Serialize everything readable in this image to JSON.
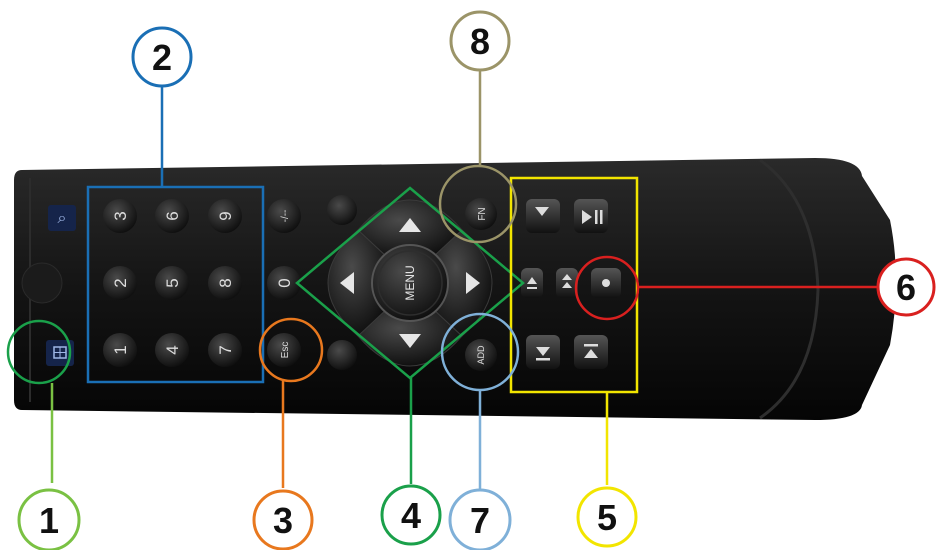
{
  "colors": {
    "c1": "#7ac143",
    "c2": "#1a6fb5",
    "c3": "#e8781e",
    "c4": "#1aa04a",
    "c5": "#f2e500",
    "c6": "#d9201f",
    "c7": "#7fb0d8",
    "c8": "#9b9468"
  },
  "callouts": [
    {
      "id": "1",
      "label": "1",
      "target": "zoom-split-keys"
    },
    {
      "id": "2",
      "label": "2",
      "target": "number-keys"
    },
    {
      "id": "3",
      "label": "3",
      "target": "esc-key"
    },
    {
      "id": "4",
      "label": "4",
      "target": "direction-pad"
    },
    {
      "id": "5",
      "label": "5",
      "target": "playback-keys"
    },
    {
      "id": "6",
      "label": "6",
      "target": "record-key"
    },
    {
      "id": "7",
      "label": "7",
      "target": "add-key"
    },
    {
      "id": "8",
      "label": "8",
      "target": "fn-key"
    }
  ],
  "remote": {
    "number_keys": [
      "3",
      "6",
      "9",
      "2",
      "5",
      "8",
      "1",
      "4",
      "7"
    ],
    "key_zero": "0",
    "key_dash": "-/--",
    "key_esc": "Esc",
    "key_menu": "MENU",
    "key_fn": "FN",
    "key_add": "ADD"
  }
}
